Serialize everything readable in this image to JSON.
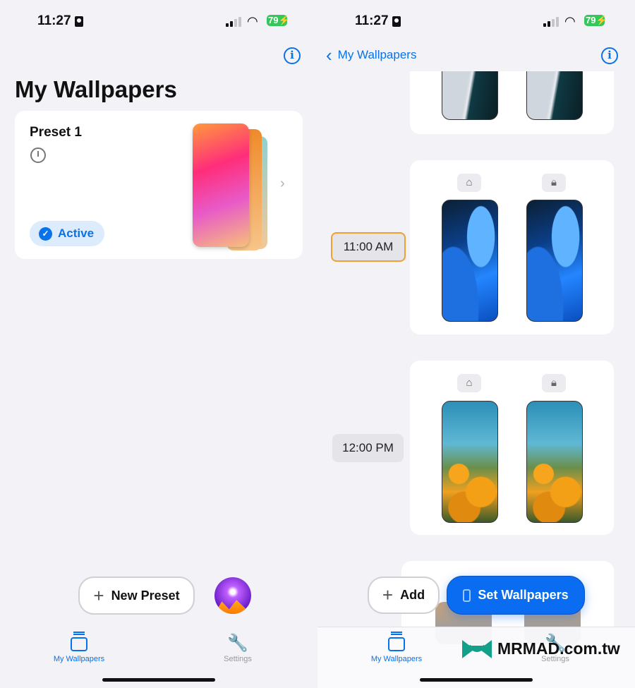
{
  "status": {
    "time": "11:27",
    "battery": "79"
  },
  "left": {
    "title": "My Wallpapers",
    "preset": {
      "name": "Preset 1",
      "status": "Active",
      "icon": "clock-icon"
    },
    "new_preset": "New Preset"
  },
  "right": {
    "back_label": "My Wallpapers",
    "schedule": [
      {
        "time": "11:00 AM",
        "selected": true
      },
      {
        "time": "12:00 PM",
        "selected": false
      }
    ],
    "add": "Add",
    "set_wallpapers": "Set Wallpapers"
  },
  "tabs": [
    {
      "label": "My Wallpapers",
      "active": true
    },
    {
      "label": "Settings",
      "active": false
    }
  ],
  "watermark": "MRMAD.com.tw",
  "colors": {
    "accent": "#0a72e8",
    "selected_border": "#f0a030",
    "active_bg": "#dcecfc"
  }
}
